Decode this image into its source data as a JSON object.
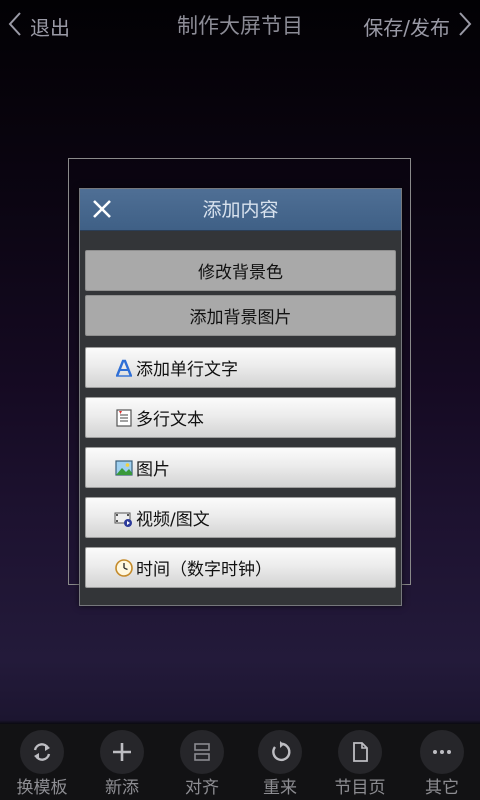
{
  "header": {
    "back_label": "退出",
    "title": "制作大屏节目",
    "save_label": "保存/发布"
  },
  "dialog": {
    "title": "添加内容",
    "options": [
      {
        "label": "修改背景色",
        "icon": null
      },
      {
        "label": "添加背景图片",
        "icon": null
      },
      {
        "label": "添加单行文字",
        "icon": "text-a-icon"
      },
      {
        "label": "多行文本",
        "icon": "document-icon"
      },
      {
        "label": "图片",
        "icon": "picture-icon"
      },
      {
        "label": "视频/图文",
        "icon": "video-icon"
      },
      {
        "label": "时间（数字时钟）",
        "icon": "clock-icon"
      }
    ]
  },
  "toolbar": {
    "items": [
      {
        "label": "换模板",
        "icon": "refresh-icon"
      },
      {
        "label": "新添",
        "icon": "plus-icon"
      },
      {
        "label": "对齐",
        "icon": "align-icon"
      },
      {
        "label": "重来",
        "icon": "undo-icon"
      },
      {
        "label": "节目页",
        "icon": "page-icon"
      },
      {
        "label": "其它",
        "icon": "more-icon"
      }
    ]
  },
  "colors": {
    "dialog_header": "#45668c",
    "dialog_body": "#333538",
    "toolbar_bg": "#121214",
    "text_dim": "#8d8d92"
  }
}
